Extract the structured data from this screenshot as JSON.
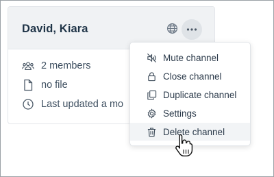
{
  "card": {
    "title": "David, Kiara",
    "info": {
      "members": "2 members",
      "file": "no file",
      "updated": "Last updated a mo"
    }
  },
  "menu": {
    "items": [
      {
        "label": "Mute channel",
        "icon": "mute-icon"
      },
      {
        "label": "Close channel",
        "icon": "lock-icon"
      },
      {
        "label": "Duplicate channel",
        "icon": "duplicate-icon"
      },
      {
        "label": "Settings",
        "icon": "gear-icon"
      },
      {
        "label": "Delete channel",
        "icon": "trash-icon",
        "hovered": true
      }
    ]
  },
  "colors": {
    "header_bg": "#f0f2f4",
    "title": "#1f3447",
    "text": "#3e4f60",
    "hover_bg": "#f2f4f6"
  }
}
